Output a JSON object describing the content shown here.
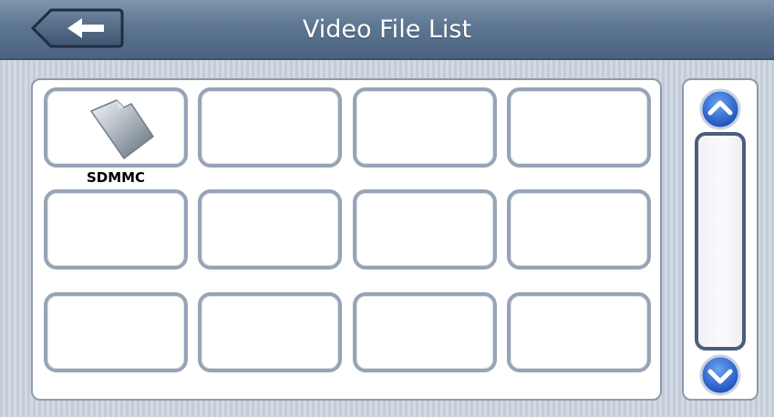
{
  "header": {
    "title": "Video File List",
    "back_icon": "back-arrow-icon"
  },
  "grid": {
    "items": [
      {
        "label": "SDMMC",
        "icon": "sd-card-icon"
      },
      {
        "label": ""
      },
      {
        "label": ""
      },
      {
        "label": ""
      },
      {
        "label": ""
      },
      {
        "label": ""
      },
      {
        "label": ""
      },
      {
        "label": ""
      },
      {
        "label": ""
      },
      {
        "label": ""
      },
      {
        "label": ""
      },
      {
        "label": ""
      }
    ]
  },
  "scrollbar": {
    "up_icon": "chevron-up-icon",
    "down_icon": "chevron-down-icon"
  },
  "colors": {
    "header": "#5d7691",
    "cell_border": "#97a4b6",
    "scroll_button": "#1f5fd0"
  }
}
